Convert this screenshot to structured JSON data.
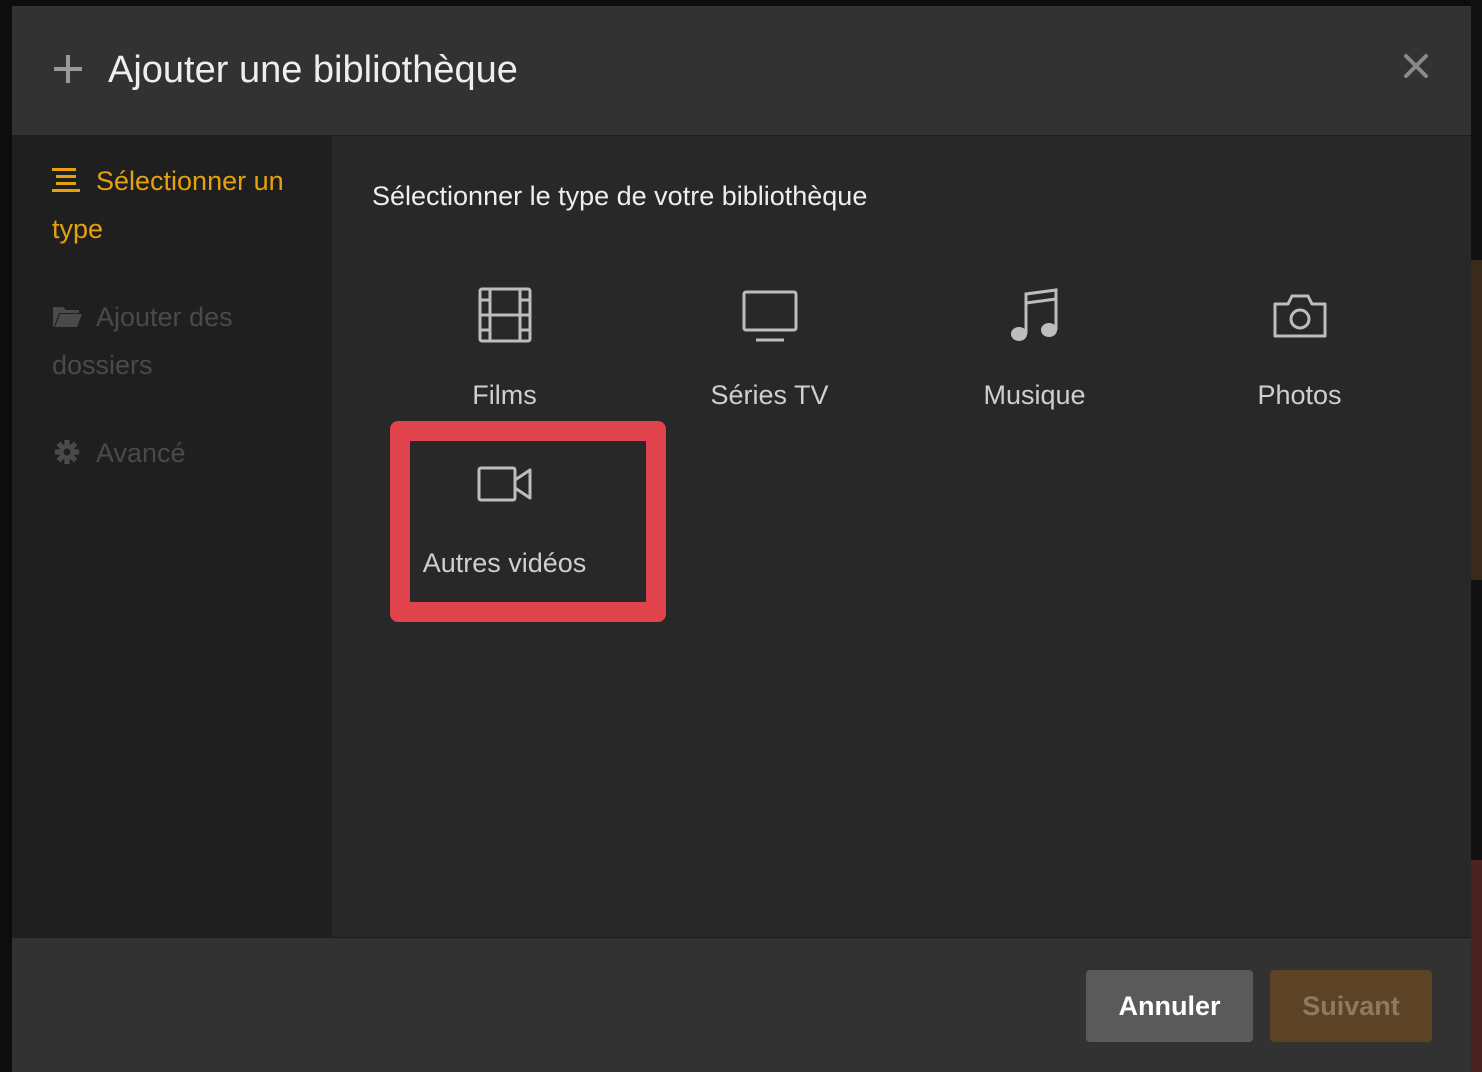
{
  "dialog": {
    "title": "Ajouter une bibliothèque",
    "header_icon": "plus-icon",
    "close_icon": "close-icon"
  },
  "sidebar": {
    "items": [
      {
        "label": "Sélectionner un type",
        "icon": "list-icon",
        "state": "active"
      },
      {
        "label": "Ajouter des dossiers",
        "icon": "folder-icon",
        "state": "disabled"
      },
      {
        "label": "Avancé",
        "icon": "gear-icon",
        "state": "disabled"
      }
    ]
  },
  "content": {
    "heading": "Sélectionner le type de votre bibliothèque",
    "types": [
      {
        "label": "Films",
        "icon": "film-icon"
      },
      {
        "label": "Séries TV",
        "icon": "tv-icon"
      },
      {
        "label": "Musique",
        "icon": "music-note-icon"
      },
      {
        "label": "Photos",
        "icon": "camera-icon"
      },
      {
        "label": "Autres vidéos",
        "icon": "video-camera-icon",
        "highlighted": true
      }
    ]
  },
  "footer": {
    "cancel_label": "Annuler",
    "next_label": "Suivant"
  },
  "colors": {
    "accent": "#e5a00d",
    "highlight": "#e0434b",
    "disabled": "#4a4a4a"
  }
}
